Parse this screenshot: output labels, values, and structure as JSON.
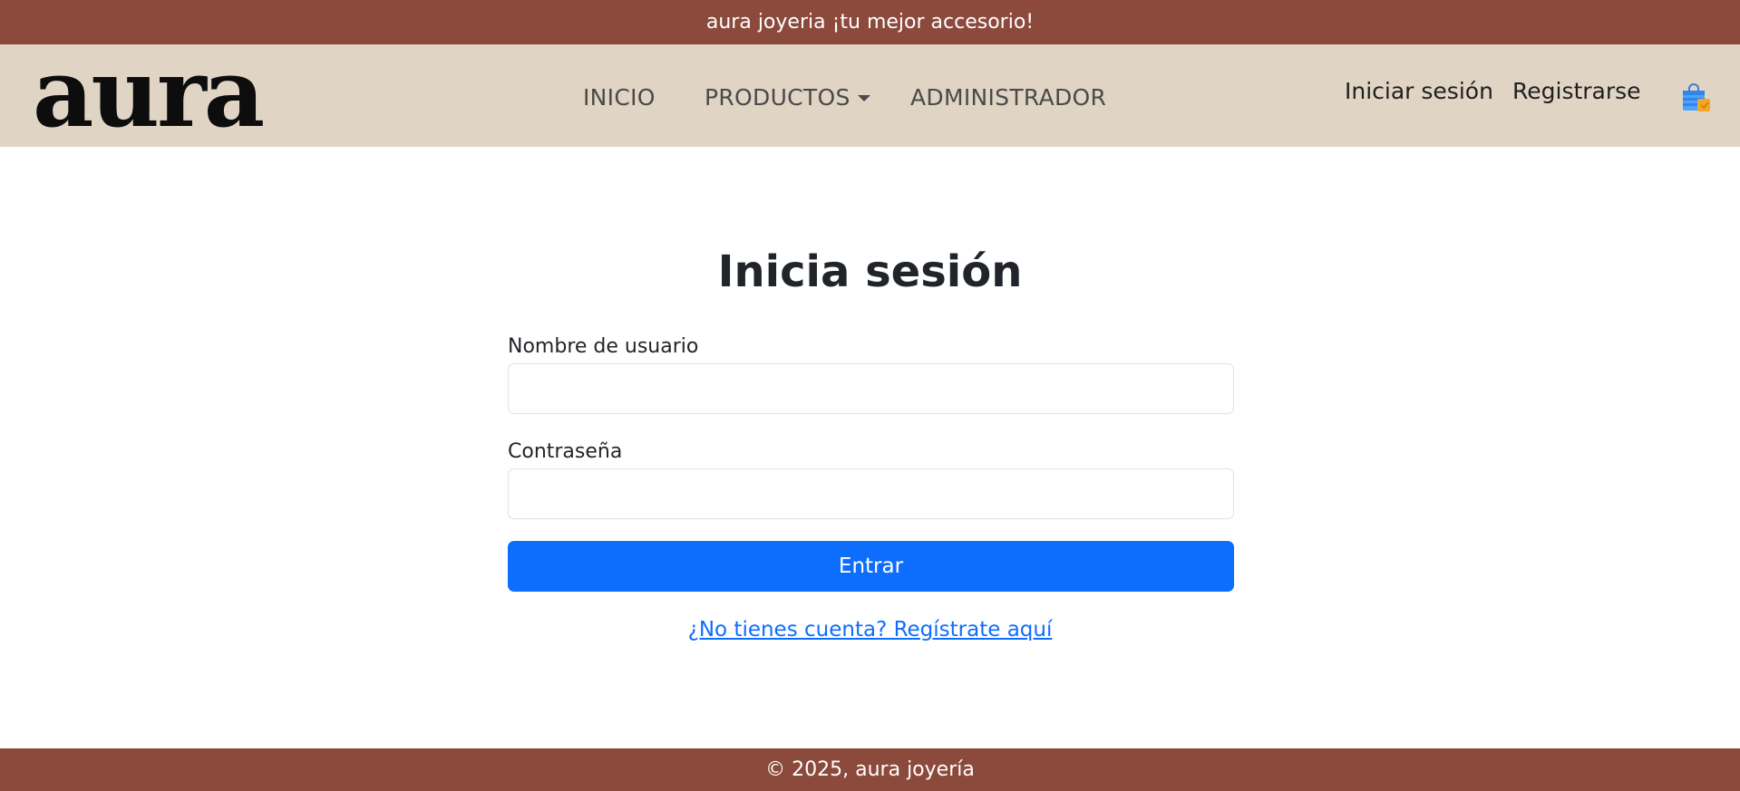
{
  "announcement": "aura joyeria ¡tu mejor accesorio!",
  "brand": {
    "logo_text": "aura"
  },
  "nav": {
    "inicio": "INICIO",
    "productos": "PRODUCTOS",
    "administrador": "ADMINISTRADOR"
  },
  "auth": {
    "login": "Iniciar sesión",
    "register": "Registrarse"
  },
  "cart": {
    "icon": "shopping-bag-icon"
  },
  "form": {
    "title": "Inicia sesión",
    "username_label": "Nombre de usuario",
    "username_value": "",
    "password_label": "Contraseña",
    "password_value": "",
    "submit_label": "Entrar",
    "register_prompt": "¿No tienes cuenta? Regístrate aquí"
  },
  "footer": {
    "text": "© 2025, aura joyería"
  },
  "colors": {
    "bar_brown": "#8b4a3b",
    "nav_beige": "#e0d4c4",
    "primary_blue": "#0d6efd"
  }
}
